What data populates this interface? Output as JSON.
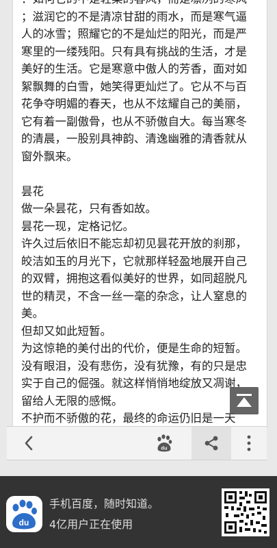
{
  "article": {
    "lines": [
      "：如何它的不是轻柔的春风，而是凛冽的寒风",
      "；滋润它的不是清凉甘甜的雨水，而是寒气逼",
      "人的冰雪；照耀它的不是灿烂的阳光，而是严",
      "寒里的一缕残阳。只有具有挑战的生活，才是",
      "美好的生活。它是寒意中傲人的芳香，面对如",
      "絮飘舞的白雪，她笑得更灿烂了。它从不与百",
      "花争夺明媚的春天，也从不炫耀自己的美丽，",
      "它有着一副傲骨，也从不骄傲自大。每当寒冬",
      "的清晨，一股别具神韵、清逸幽雅的清香就从",
      "窗外飘来。",
      "",
      "昙花",
      "做一朵昙花，只有香如故。",
      "昙花一现，定格记忆。",
      "许久过后依旧不能忘却初见昙花开放的刹那，",
      "皎洁如玉的月光下，它就那样轻盈地展开自己",
      "的双臂，拥抱这看似美好的世界，如同超脱凡",
      "世的精灵，不含一丝一毫的杂念，让人窒息的",
      "美。",
      "但却又如此短暂。",
      "为这惊艳的美付出的代价，便是生命的短暂。",
      "没有眼泪，没有悲伤，没有犹豫，有的只是忠",
      "实于自己的倔强。就这样悄悄地绽放又凋谢，",
      "留给人无限的感慨。",
      "不护而不骄傲的花，最终的命运仍旧是一天"
    ]
  },
  "toolbar": {
    "back_icon": "chevron-left-icon",
    "paw_icon": "baidu-paw-icon",
    "paw_label": "du",
    "share_icon": "share-icon",
    "more_icon": "more-vertical-icon"
  },
  "ad": {
    "app_icon": "baidu-paw-icon",
    "app_icon_label": "du",
    "slogan": "手机百度，随时知道。",
    "users": "4亿用户正在使用",
    "qr_icon": "qr-code-icon"
  },
  "colors": {
    "text": "#222222",
    "baidu_blue": "#2d6ec9",
    "banner_bg": "#333333",
    "toolbar_bg": "#f3f3f3"
  }
}
